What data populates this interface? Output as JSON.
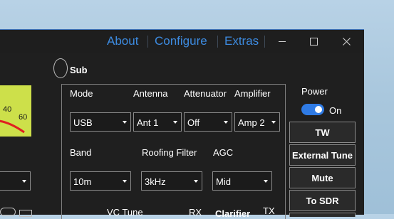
{
  "titlebar": {
    "menu": [
      "About",
      "Configure",
      "Extras"
    ],
    "minimize_icon": "minimize-icon",
    "maximize_icon": "maximize-icon",
    "close_icon": "close-icon"
  },
  "sub_radio": {
    "label": "Sub",
    "checked": false
  },
  "meter": {
    "scale_labels": [
      "40",
      "60"
    ],
    "background_color": "#cde04a",
    "needle_color": "#e02020"
  },
  "row1": {
    "labels": {
      "mode": "Mode",
      "antenna": "Antenna",
      "attenuator": "Attenuator",
      "amplifier": "Amplifier"
    },
    "values": {
      "mode": "USB",
      "antenna": "Ant 1",
      "attenuator": "Off",
      "amplifier": "Amp 2"
    }
  },
  "row2": {
    "labels": {
      "band": "Band",
      "roofing_filter": "Roofing Filter",
      "agc": "AGC"
    },
    "values": {
      "band": "10m",
      "roofing_filter": "3kHz",
      "agc": "Mid"
    }
  },
  "bottom_labels": {
    "vc_tune": "VC Tune",
    "rx": "RX",
    "clarifier": "Clarifier",
    "tx": "TX"
  },
  "power": {
    "label": "Power",
    "state": "On",
    "enabled": true,
    "toggle_color": "#2f7be5"
  },
  "side_buttons": [
    "TW",
    "External Tune",
    "Mute",
    "To SDR"
  ],
  "colors": {
    "accent": "#3d8be0",
    "window_bg": "#1f1f1f"
  }
}
